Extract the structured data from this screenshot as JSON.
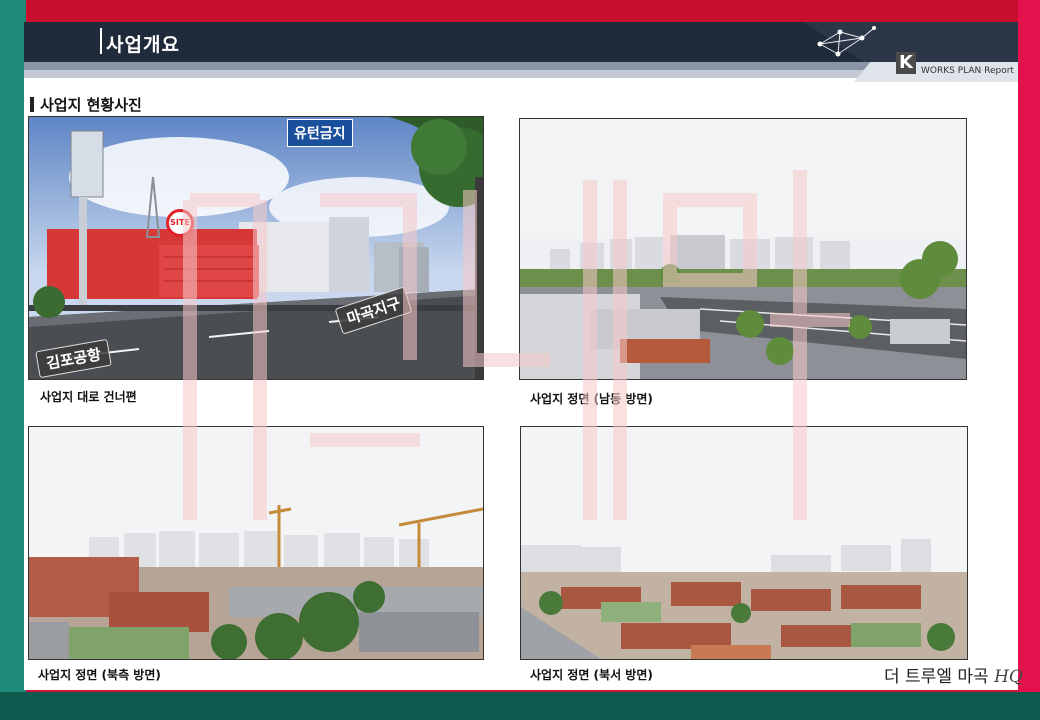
{
  "header": {
    "title": "사업개요",
    "logo_letter": "K",
    "logo_text": "WORKS PLAN Report"
  },
  "section": {
    "title": "사업지 현황사진"
  },
  "photos": [
    {
      "caption": "사업지 대로 건너편",
      "labels": {
        "sign": "유턴금지",
        "road_right": "마곡지구",
        "road_left": "김포공항",
        "site": "SITE"
      }
    },
    {
      "caption": "사업지 정면 (남동 방면)"
    },
    {
      "caption": "사업지 정면 (북측 방면)"
    },
    {
      "caption": "사업지 정면 (북서 방면)"
    }
  ],
  "brand": {
    "text": "더 트루엘 마곡",
    "script": "HQ"
  },
  "colors": {
    "frame_red": "#d0103a",
    "frame_teal": "#1f8a7a",
    "header_dark": "#1f2a3a",
    "site_highlight": "#e21f26"
  }
}
